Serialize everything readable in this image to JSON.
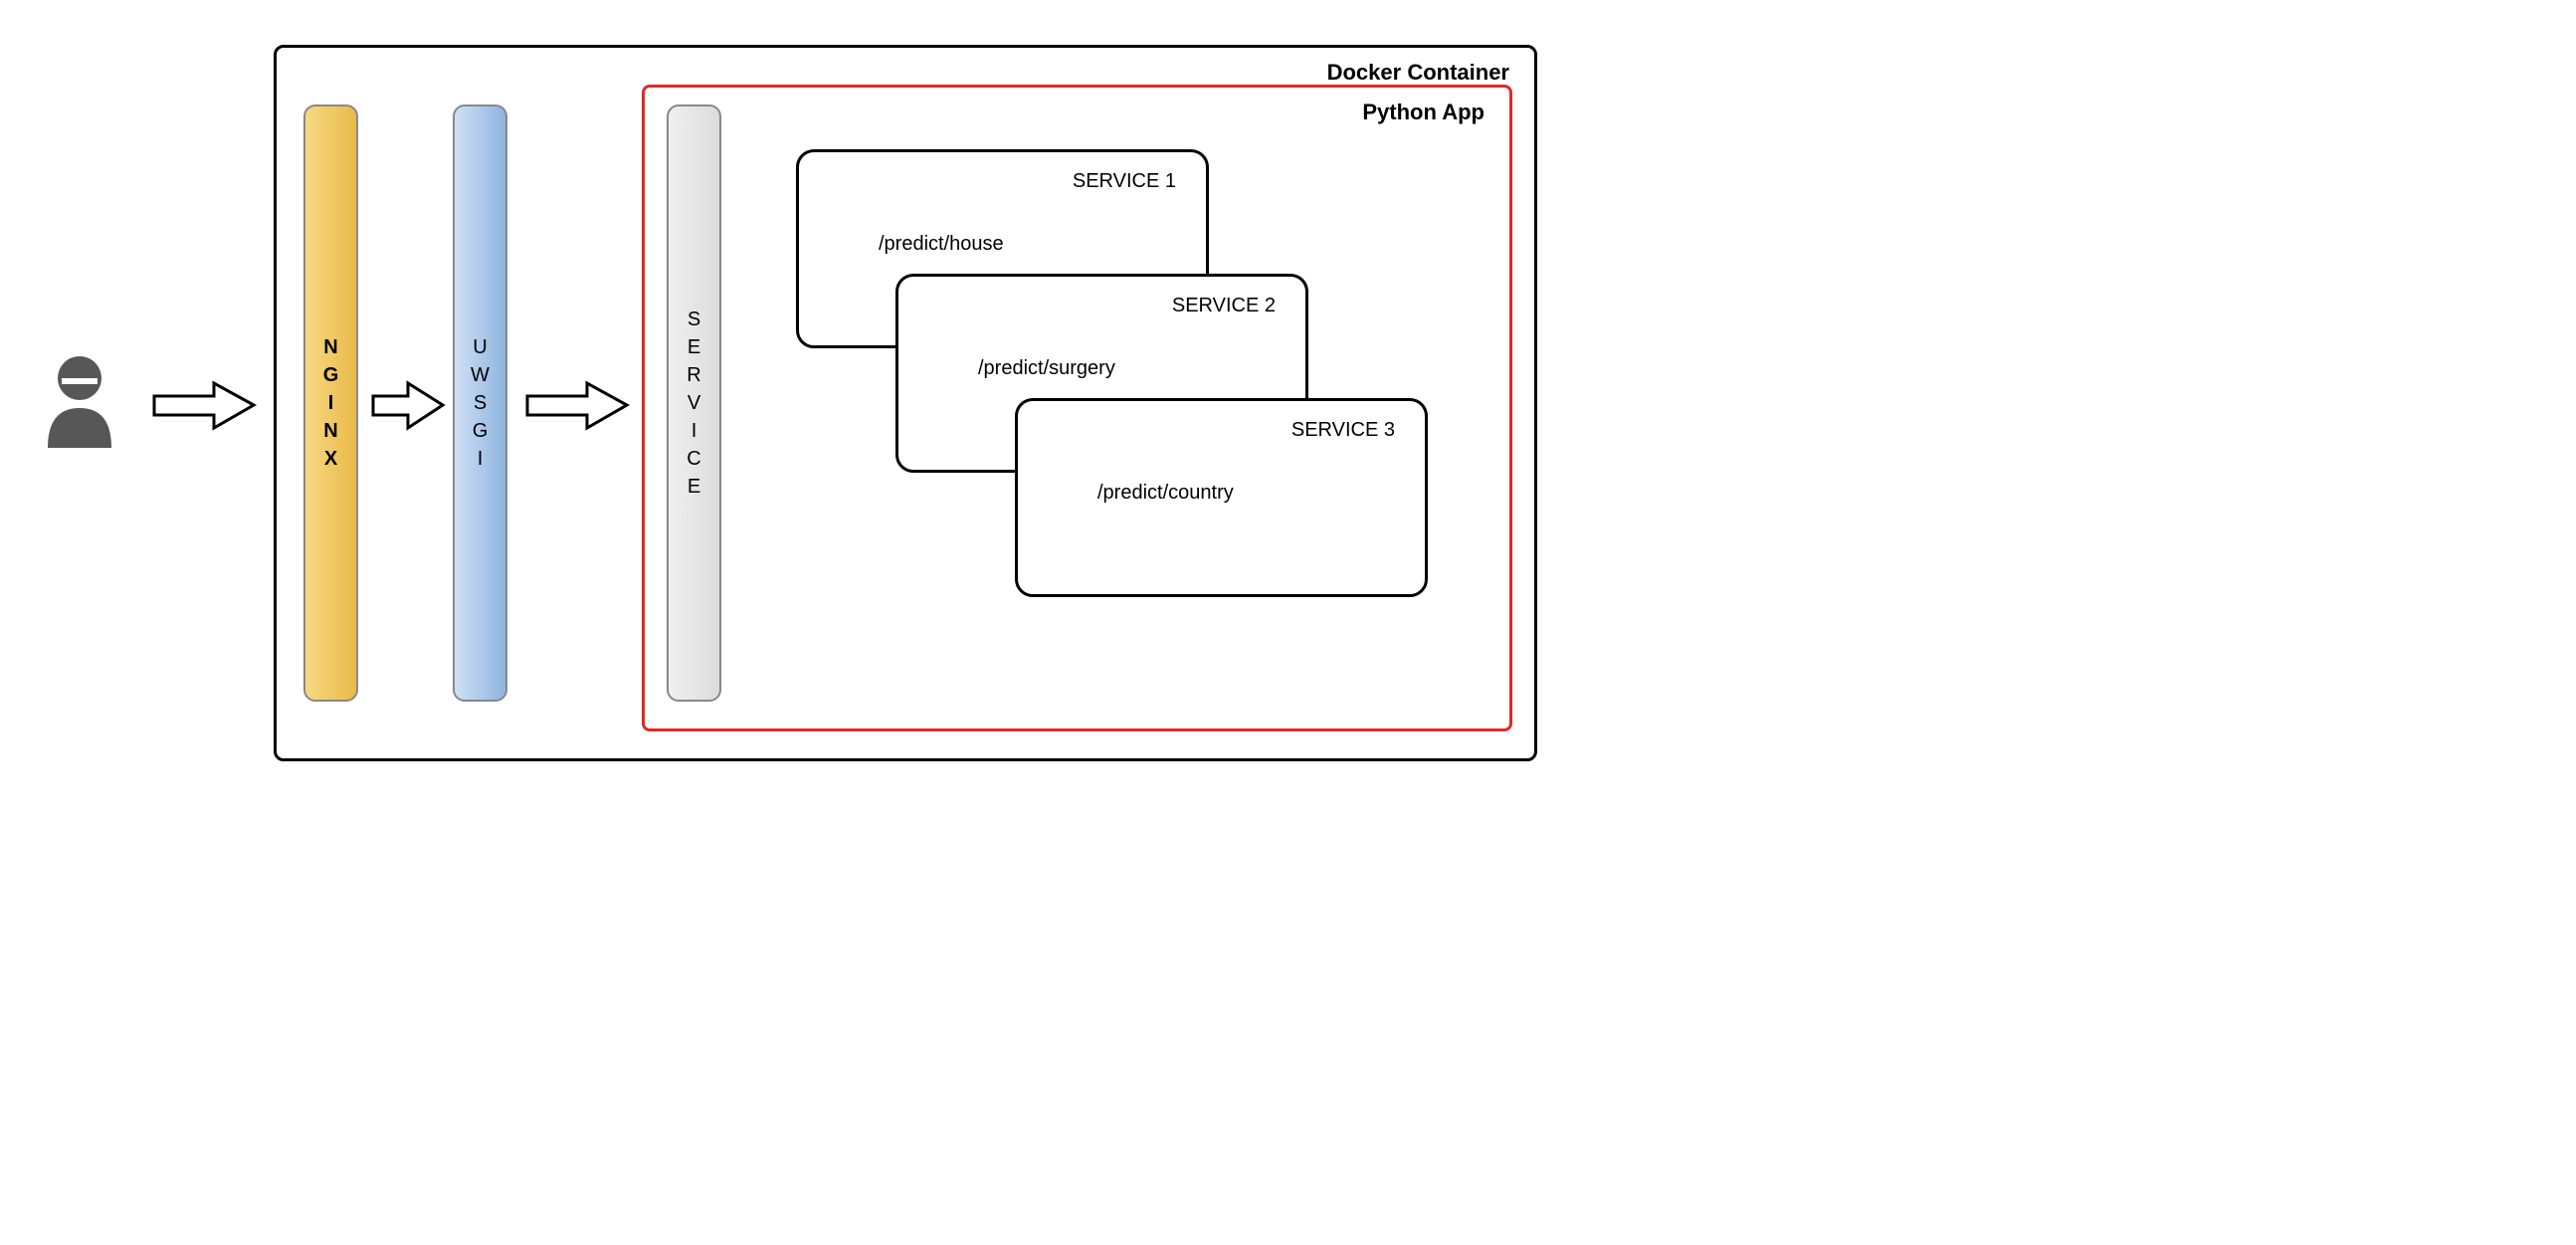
{
  "dockerLabel": "Docker Container",
  "pythonLabel": "Python App",
  "nginxLabel": "NGINX",
  "uwsgiLabel": "UWSGI",
  "serviceLabel": "SERVICE",
  "services": [
    {
      "name": "SERVICE 1",
      "route": "/predict/house"
    },
    {
      "name": "SERVICE 2",
      "route": "/predict/surgery"
    },
    {
      "name": "SERVICE 3",
      "route": "/predict/country"
    }
  ]
}
